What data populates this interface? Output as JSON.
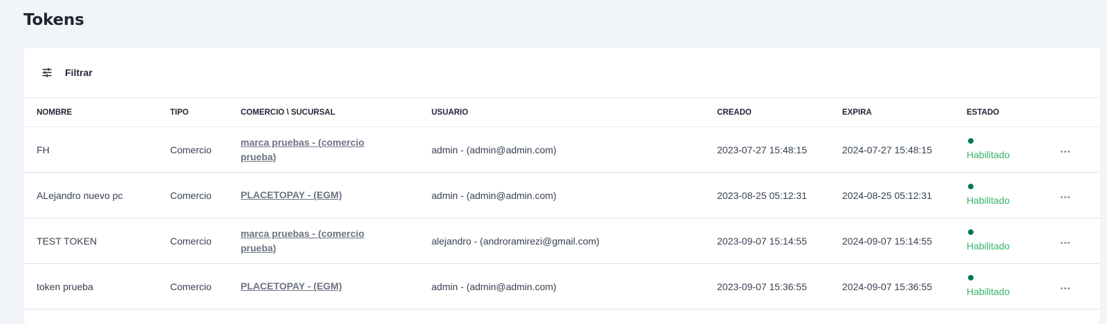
{
  "page": {
    "title": "Tokens"
  },
  "filter": {
    "label": "Filtrar",
    "icon": "sliders-icon"
  },
  "table": {
    "headers": {
      "name": "NOMBRE",
      "type": "TIPO",
      "merchant": "COMERCIO \\ SUCURSAL",
      "user": "USUARIO",
      "created": "CREADO",
      "expires": "EXPIRA",
      "status": "ESTADO"
    },
    "rows": [
      {
        "name": "FH",
        "type": "Comercio",
        "merchant": "marca pruebas - (comercio prueba)",
        "user": "admin - (admin@admin.com)",
        "created": "2023-07-27 15:48:15",
        "expires": "2024-07-27 15:48:15",
        "status": "Habilitado"
      },
      {
        "name": "ALejandro nuevo pc",
        "type": "Comercio",
        "merchant": "PLACETOPAY - (EGM)",
        "user": "admin - (admin@admin.com)",
        "created": "2023-08-25 05:12:31",
        "expires": "2024-08-25 05:12:31",
        "status": "Habilitado"
      },
      {
        "name": "TEST TOKEN",
        "type": "Comercio",
        "merchant": "marca pruebas - (comercio prueba)",
        "user": "alejandro - (androramirezi@gmail.com)",
        "created": "2023-09-07 15:14:55",
        "expires": "2024-09-07 15:14:55",
        "status": "Habilitado"
      },
      {
        "name": "token prueba",
        "type": "Comercio",
        "merchant": "PLACETOPAY - (EGM)",
        "user": "admin - (admin@admin.com)",
        "created": "2023-09-07 15:36:55",
        "expires": "2024-09-07 15:36:55",
        "status": "Habilitado"
      }
    ]
  },
  "colors": {
    "background": "#f1f4f8",
    "status_dot": "#047857",
    "status_text": "#34b36a",
    "link": "#6b7280"
  }
}
